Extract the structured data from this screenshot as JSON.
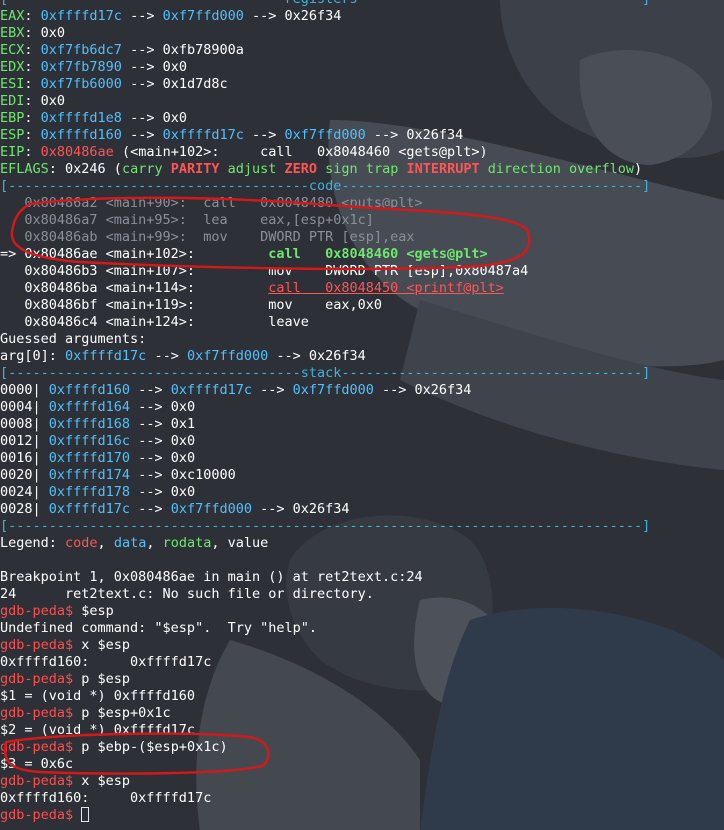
{
  "colors": {
    "background": "#2d3036",
    "fg": "#ffffff",
    "addr": "#4fc1ff",
    "red": "#ff5555",
    "green": "#6ee86e",
    "yellow": "#ffea63",
    "dim": "#8a9099",
    "rule": "#3fb3d9",
    "prompt": "#ff4d4d",
    "annotation": "#d81818"
  },
  "icons": {
    "cursor": "block-cursor-icon"
  },
  "lines": [
    [
      {
        "t": "[----------------------------------registers-----------------------------------]",
        "c": "rule"
      }
    ],
    [
      {
        "t": "EAX",
        "c": "green"
      },
      {
        "t": ": "
      },
      {
        "t": "0xffffd17c",
        "c": "addr"
      },
      {
        "t": " --> "
      },
      {
        "t": "0xf7ffd000",
        "c": "addr"
      },
      {
        "t": " --> 0x26f34"
      }
    ],
    [
      {
        "t": "EBX",
        "c": "green"
      },
      {
        "t": ": 0x0"
      }
    ],
    [
      {
        "t": "ECX",
        "c": "green"
      },
      {
        "t": ": "
      },
      {
        "t": "0xf7fb6dc7",
        "c": "addr"
      },
      {
        "t": " --> 0xfb78900a"
      }
    ],
    [
      {
        "t": "EDX",
        "c": "green"
      },
      {
        "t": ": "
      },
      {
        "t": "0xf7fb7890",
        "c": "addr"
      },
      {
        "t": " --> 0x0"
      }
    ],
    [
      {
        "t": "ESI",
        "c": "green"
      },
      {
        "t": ": "
      },
      {
        "t": "0xf7fb6000",
        "c": "addr"
      },
      {
        "t": " --> 0x1d7d8c"
      }
    ],
    [
      {
        "t": "EDI",
        "c": "green"
      },
      {
        "t": ": 0x0"
      }
    ],
    [
      {
        "t": "EBP",
        "c": "green"
      },
      {
        "t": ": "
      },
      {
        "t": "0xffffd1e8",
        "c": "addr"
      },
      {
        "t": " --> 0x0"
      }
    ],
    [
      {
        "t": "ESP",
        "c": "green"
      },
      {
        "t": ": "
      },
      {
        "t": "0xffffd160",
        "c": "addr"
      },
      {
        "t": " --> "
      },
      {
        "t": "0xffffd17c",
        "c": "addr"
      },
      {
        "t": " --> "
      },
      {
        "t": "0xf7ffd000",
        "c": "addr"
      },
      {
        "t": " --> 0x26f34"
      }
    ],
    [
      {
        "t": "EIP",
        "c": "green"
      },
      {
        "t": ": "
      },
      {
        "t": "0x80486ae",
        "c": "red"
      },
      {
        "t": " (<main+102>:     call   0x8048460 <gets@plt>)"
      }
    ],
    [
      {
        "t": "EFLAGS",
        "c": "green"
      },
      {
        "t": ": 0x246 ("
      },
      {
        "t": "carry ",
        "c": "green"
      },
      {
        "t": "PARITY",
        "c": "red",
        "b": true
      },
      {
        "t": " adjust ",
        "c": "green"
      },
      {
        "t": "ZERO",
        "c": "red",
        "b": true
      },
      {
        "t": " sign trap ",
        "c": "green"
      },
      {
        "t": "INTERRUPT",
        "c": "red",
        "b": true
      },
      {
        "t": " direction overflow",
        "c": "green"
      },
      {
        "t": ")"
      }
    ],
    [
      {
        "t": "[-------------------------------------code-------------------------------------]",
        "c": "rule"
      }
    ],
    [
      {
        "t": "   0x80486a2 <main+90>:  call   0x8048480 <puts@plt>",
        "c": "dim"
      }
    ],
    [
      {
        "t": "   0x80486a7 <main+95>:  ",
        "c": "dim"
      },
      {
        "t": "lea    eax,[esp+0x1c]",
        "c": "dim"
      }
    ],
    [
      {
        "t": "   0x80486ab <main+99>:  ",
        "c": "dim"
      },
      {
        "t": "mov    DWORD PTR [esp],eax",
        "c": "dim"
      }
    ],
    [
      {
        "t": "=> 0x80486ae <main+102>:         "
      },
      {
        "t": "call   0x8048460 <gets@plt>",
        "c": "green",
        "b": true
      }
    ],
    [
      {
        "t": "   0x80486b3 <main+107>:         mov    DWORD PTR [esp],0x80487a4"
      }
    ],
    [
      {
        "t": "   0x80486ba <main+114>:         "
      },
      {
        "t": "call   0x8048450 <printf@plt>",
        "c": "red",
        "u": true
      }
    ],
    [
      {
        "t": "   0x80486bf <main+119>:         mov    eax,0x0"
      }
    ],
    [
      {
        "t": "   0x80486c4 <main+124>:         leave"
      }
    ],
    [
      {
        "t": "Guessed arguments:"
      }
    ],
    [
      {
        "t": "arg[0]: "
      },
      {
        "t": "0xffffd17c",
        "c": "addr"
      },
      {
        "t": " --> "
      },
      {
        "t": "0xf7ffd000",
        "c": "addr"
      },
      {
        "t": " --> 0x26f34"
      }
    ],
    [
      {
        "t": "[------------------------------------stack-------------------------------------]",
        "c": "rule"
      }
    ],
    [
      {
        "t": "0000| "
      },
      {
        "t": "0xffffd160",
        "c": "addr"
      },
      {
        "t": " --> "
      },
      {
        "t": "0xffffd17c",
        "c": "addr"
      },
      {
        "t": " --> "
      },
      {
        "t": "0xf7ffd000",
        "c": "addr"
      },
      {
        "t": " --> 0x26f34"
      }
    ],
    [
      {
        "t": "0004| "
      },
      {
        "t": "0xffffd164",
        "c": "addr"
      },
      {
        "t": " --> 0x0"
      }
    ],
    [
      {
        "t": "0008| "
      },
      {
        "t": "0xffffd168",
        "c": "addr"
      },
      {
        "t": " --> 0x1"
      }
    ],
    [
      {
        "t": "0012| "
      },
      {
        "t": "0xffffd16c",
        "c": "addr"
      },
      {
        "t": " --> 0x0"
      }
    ],
    [
      {
        "t": "0016| "
      },
      {
        "t": "0xffffd170",
        "c": "addr"
      },
      {
        "t": " --> 0x0"
      }
    ],
    [
      {
        "t": "0020| "
      },
      {
        "t": "0xffffd174",
        "c": "addr"
      },
      {
        "t": " --> 0xc10000"
      }
    ],
    [
      {
        "t": "0024| "
      },
      {
        "t": "0xffffd178",
        "c": "addr"
      },
      {
        "t": " --> 0x0"
      }
    ],
    [
      {
        "t": "0028| "
      },
      {
        "t": "0xffffd17c",
        "c": "addr"
      },
      {
        "t": " --> "
      },
      {
        "t": "0xf7ffd000",
        "c": "addr"
      },
      {
        "t": " --> 0x26f34"
      }
    ],
    [
      {
        "t": "[------------------------------------------------------------------------------]",
        "c": "rule"
      }
    ],
    [
      {
        "t": "Legend: "
      },
      {
        "t": "code",
        "c": "red"
      },
      {
        "t": ", "
      },
      {
        "t": "data",
        "c": "addr"
      },
      {
        "t": ", "
      },
      {
        "t": "rodata",
        "c": "green"
      },
      {
        "t": ", value"
      }
    ],
    [
      {
        "t": ""
      }
    ],
    [
      {
        "t": "Breakpoint 1, 0x080486ae in main () at ret2text.c:24"
      }
    ],
    [
      {
        "t": "24      ret2text.c: No such file or directory."
      }
    ],
    [
      {
        "t": "gdb-peda$",
        "c": "prompt"
      },
      {
        "t": " $esp"
      }
    ],
    [
      {
        "t": "Undefined command: \"$esp\".  Try \"help\"."
      }
    ],
    [
      {
        "t": "gdb-peda$",
        "c": "prompt"
      },
      {
        "t": " x $esp"
      }
    ],
    [
      {
        "t": "0xffffd160:     0xffffd17c"
      }
    ],
    [
      {
        "t": "gdb-peda$",
        "c": "prompt"
      },
      {
        "t": " p $esp"
      }
    ],
    [
      {
        "t": "$1 = (void *) 0xffffd160"
      }
    ],
    [
      {
        "t": "gdb-peda$",
        "c": "prompt"
      },
      {
        "t": " p $esp+0x1c"
      }
    ],
    [
      {
        "t": "$2 = (void *) 0xffffd17c"
      }
    ],
    [
      {
        "t": "gdb-peda$",
        "c": "prompt"
      },
      {
        "t": " p $ebp-($esp+0x1c)"
      }
    ],
    [
      {
        "t": "$3 = 0x6c"
      }
    ],
    [
      {
        "t": "gdb-peda$",
        "c": "prompt"
      },
      {
        "t": " x $esp"
      }
    ],
    [
      {
        "t": "0xffffd160:     0xffffd17c"
      }
    ],
    [
      {
        "t": "gdb-peda$",
        "c": "prompt"
      },
      {
        "t": " "
      },
      {
        "cursor": true
      }
    ]
  ]
}
